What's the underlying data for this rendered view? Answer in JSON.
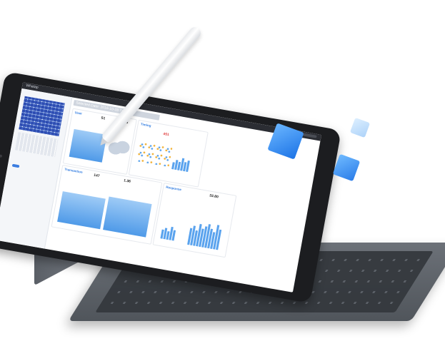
{
  "app": {
    "logo_text": "Whatap"
  },
  "dashboard": {
    "title": "Selected Date: 2016-10-28 Trade",
    "cards": {
      "user": {
        "header": "User",
        "value1": "51",
        "value2": "46"
      },
      "timing": {
        "header": "Timing",
        "value": "451"
      },
      "transaction": {
        "header": "Transaction",
        "value": "147"
      },
      "response": {
        "header": "Response",
        "value": "1.36",
        "value2": "33.80"
      }
    },
    "response_time": "1.36",
    "bars_heights": [
      60,
      70,
      55,
      80,
      65,
      75,
      85,
      70,
      60,
      88,
      72
    ]
  },
  "colors": {
    "accent": "#2f7be0",
    "chart_blue": "#5aa3ee",
    "cube": "#1d74e6"
  },
  "icons": [
    "pencil-icon",
    "cube-icon"
  ]
}
